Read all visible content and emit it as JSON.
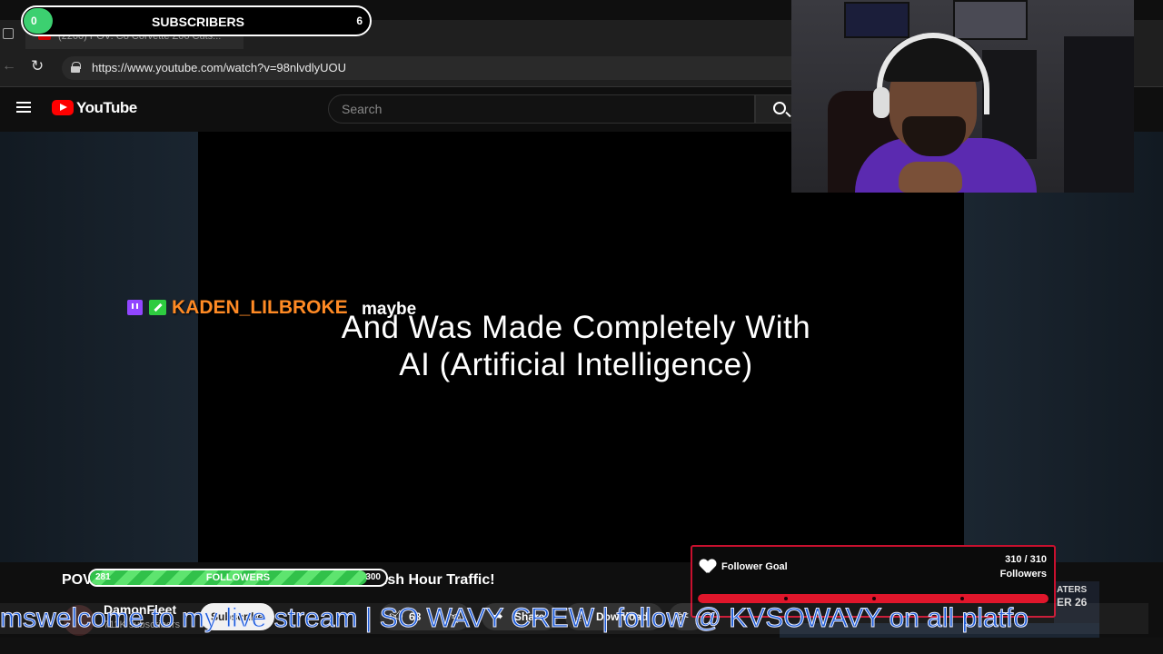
{
  "browser": {
    "tab_title": "(2260) POV: C8 Corvette Z06 Cuts...",
    "url": "https://www.youtube.com/watch?v=98nlvdlyUOU"
  },
  "youtube": {
    "logo_text": "YouTube",
    "search_placeholder": "Search"
  },
  "video": {
    "caption_line1": "And Was Made Completely With",
    "caption_line2": "AI (Artificial Intelligence)",
    "title_start": "POV",
    "title_end": "Rush Hour Traffic!"
  },
  "channel": {
    "name": "DamonFleet",
    "subscribers": "711K subscribers",
    "subscribe_label": "Subscribe"
  },
  "actions": {
    "like_count": "68",
    "share_label": "Share",
    "download_label": "Download"
  },
  "stream_overlay": {
    "chat": {
      "username": "KADEN_LILBROKE",
      "message": "maybe"
    },
    "subscribers_goal": {
      "label": "SUBSCRIBERS",
      "current": "0",
      "target": "6",
      "progress": 0.0
    },
    "followers_goal": {
      "label": "FOLLOWERS",
      "current": "281",
      "target": "300",
      "progress": 0.937
    },
    "follower_goal_widget": {
      "title": "Follower Goal",
      "count": "310 / 310",
      "unit": "Followers",
      "progress": 1.0
    },
    "ticker": "mswelcome to my live stream | SO WAVY CREW | follow @ KVSOWAVY on all platfo"
  },
  "promo": {
    "line1": "ATERS",
    "line2": "ER 26"
  },
  "colors": {
    "youtube_red": "#ff0000",
    "chat_username": "#ff8a24",
    "goal_red": "#e0162b",
    "followers_green": "#31c14a",
    "subs_green": "#3cd070",
    "ticker_blue": "#1a5ad8"
  }
}
